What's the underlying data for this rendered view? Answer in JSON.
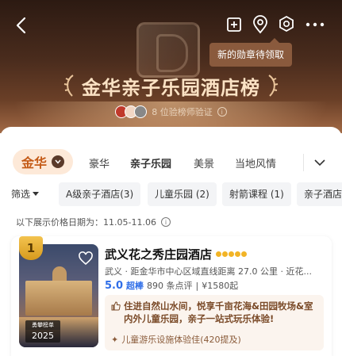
{
  "header": {
    "tooltip": "新的勋章待领取",
    "title": "金华亲子乐园酒店榜",
    "verify_text": "8 位验榜师验证",
    "info_glyph": "i"
  },
  "tabs": {
    "city": "金华",
    "items": [
      "豪华",
      "亲子乐园",
      "美景",
      "当地风情"
    ],
    "active_index": 1
  },
  "filters": {
    "first": "筛选",
    "chips": [
      "A级亲子酒店(3)",
      "儿童乐园 (2)",
      "射箭课程 (1)",
      "亲子酒店"
    ]
  },
  "date_row": {
    "text": "以下展示价格日期为：11.05-11.06"
  },
  "hotel": {
    "rank": "1",
    "award_top": "勇攀榜单",
    "award_year": "2025",
    "name": "武义花之秀庄园酒店",
    "location": "武义 · 距金华市中心区域直线距离 27.0 公里 · 近花...",
    "score": "5.0",
    "score_word": "超棒",
    "reviews": "890 条点评",
    "price": "¥1580起",
    "promo_text": "住进自然山水间，悦享千亩花海&田园牧场&室内外儿童乐园，亲子一站式玩乐体验!",
    "tag": "儿童游乐设施体验佳(420提及)"
  },
  "colors": {
    "accent": "#c45a16",
    "brand_score": "#2f6ee8",
    "header_dark": "#2c1a12",
    "tooltip_bg": "#8a5a3d"
  }
}
